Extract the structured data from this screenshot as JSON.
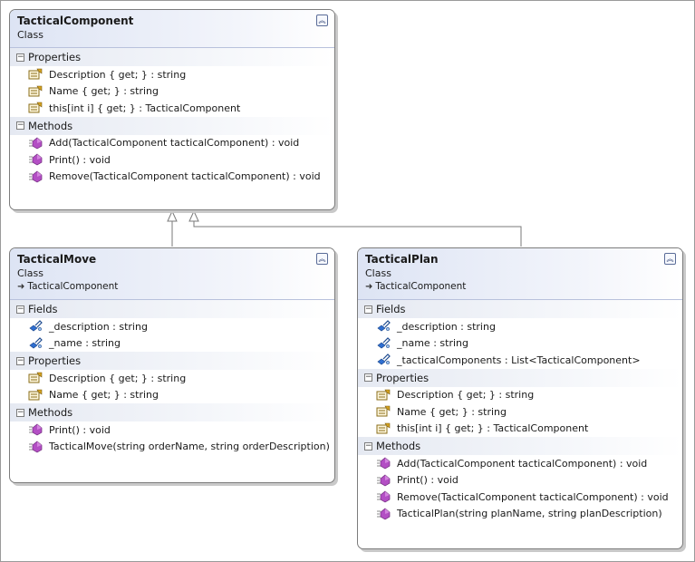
{
  "diagram": {
    "classes": {
      "component": {
        "name": "TacticalComponent",
        "stereotype": "Class",
        "properties_title": "Properties",
        "properties": [
          "Description { get; } : string",
          "Name { get; } : string",
          "this[int i] { get; } : TacticalComponent"
        ],
        "methods_title": "Methods",
        "methods": [
          "Add(TacticalComponent tacticalComponent) : void",
          "Print() : void",
          "Remove(TacticalComponent tacticalComponent) : void"
        ]
      },
      "move": {
        "name": "TacticalMove",
        "stereotype": "Class",
        "inherits": "TacticalComponent",
        "fields_title": "Fields",
        "fields": [
          "_description : string",
          "_name : string"
        ],
        "properties_title": "Properties",
        "properties": [
          "Description { get; } : string",
          "Name { get; } : string"
        ],
        "methods_title": "Methods",
        "methods": [
          "Print() : void",
          "TacticalMove(string orderName, string orderDescription)"
        ]
      },
      "plan": {
        "name": "TacticalPlan",
        "stereotype": "Class",
        "inherits": "TacticalComponent",
        "fields_title": "Fields",
        "fields": [
          "_description : string",
          "_name : string",
          "_tacticalComponents : List<TacticalComponent>"
        ],
        "properties_title": "Properties",
        "properties": [
          "Description { get; } : string",
          "Name { get; } : string",
          "this[int i] { get; } : TacticalComponent"
        ],
        "methods_title": "Methods",
        "methods": [
          "Add(TacticalComponent tacticalComponent) : void",
          "Print() : void",
          "Remove(TacticalComponent tacticalComponent) : void",
          "TacticalPlan(string planName, string planDescription)"
        ]
      }
    },
    "icons": {
      "collapse": "chevron-collapse-icon",
      "property": "property-icon",
      "method": "method-icon",
      "field": "field-icon",
      "inherits": "inheritance-arrow-icon"
    },
    "colors": {
      "header_gradient": "#dde4f4",
      "border": "#7c7c7c",
      "method_icon": "#b34fc4",
      "field_icon": "#2f6fd1",
      "property_icon": "#d4a21f"
    }
  }
}
